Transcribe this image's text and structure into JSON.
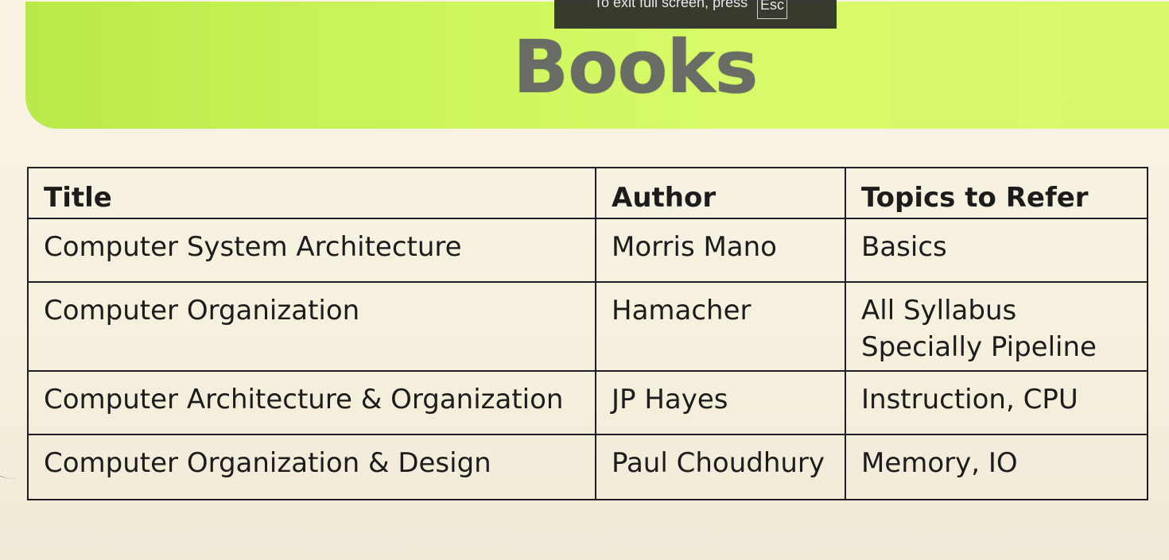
{
  "fullscreen_notice": {
    "text": "To exit full screen, press",
    "key": "Esc"
  },
  "slide": {
    "title": "Books",
    "table": {
      "headers": [
        "Title",
        "Author",
        "Topics to Refer"
      ],
      "rows": [
        {
          "title": "Computer System Architecture",
          "author": "Morris Mano",
          "topics": [
            "Basics"
          ]
        },
        {
          "title": "Computer Organization",
          "author": "Hamacher",
          "topics": [
            "All Syllabus",
            "Specially Pipeline"
          ]
        },
        {
          "title": "Computer Architecture & Organization",
          "author": "JP Hayes",
          "topics": [
            "Instruction, CPU"
          ]
        },
        {
          "title": "Computer Organization & Design",
          "author": "Paul Choudhury",
          "topics": [
            "Memory, IO"
          ]
        }
      ]
    }
  },
  "colors": {
    "banner_green": "#cdf55c",
    "background": "#f6f0de",
    "title_gray": "#6a6d66"
  }
}
